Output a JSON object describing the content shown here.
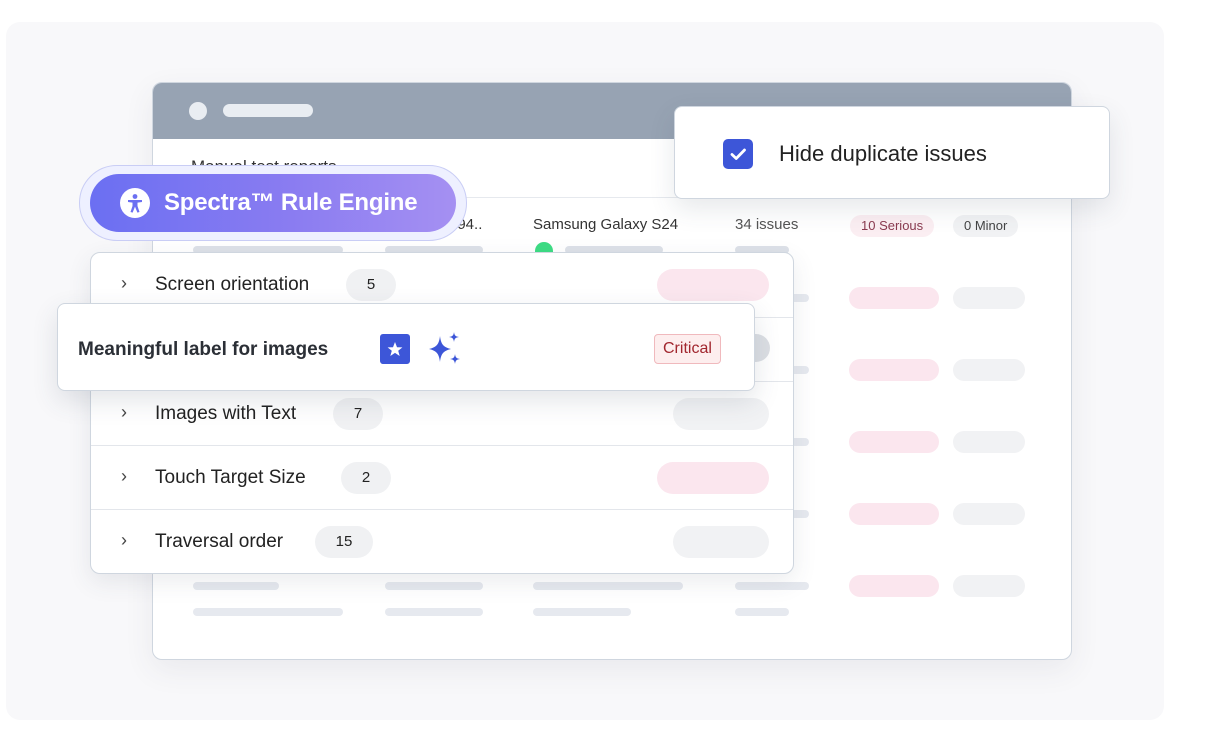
{
  "window": {
    "title": "Manual test reports",
    "row": {
      "device_fragment": "194..",
      "device": "Samsung Galaxy S24",
      "issues": "34 issues",
      "serious": "10 Serious",
      "minor": "0 Minor"
    }
  },
  "engine": {
    "label": "Spectra™ Rule Engine",
    "icon": "accessibility-icon"
  },
  "categories": [
    {
      "label": "Screen orientation",
      "count": "5",
      "icon": "chevron-right-icon"
    },
    {
      "label": "Images with Text",
      "count": "7",
      "icon": "chevron-right-icon"
    },
    {
      "label": "Touch Target Size",
      "count": "2",
      "icon": "chevron-right-icon"
    },
    {
      "label": "Traversal order",
      "count": "15",
      "icon": "chevron-right-icon"
    }
  ],
  "highlight": {
    "label": "Meaningful label for images",
    "severity": "Critical",
    "icons": [
      "star-icon",
      "sparkle-icon"
    ]
  },
  "filter": {
    "label": "Hide duplicate issues",
    "checked": true
  },
  "colors": {
    "accent": "#3d56d8",
    "engine_start": "#6b6ff2",
    "engine_end": "#a590f2",
    "critical": "#a1262e"
  }
}
